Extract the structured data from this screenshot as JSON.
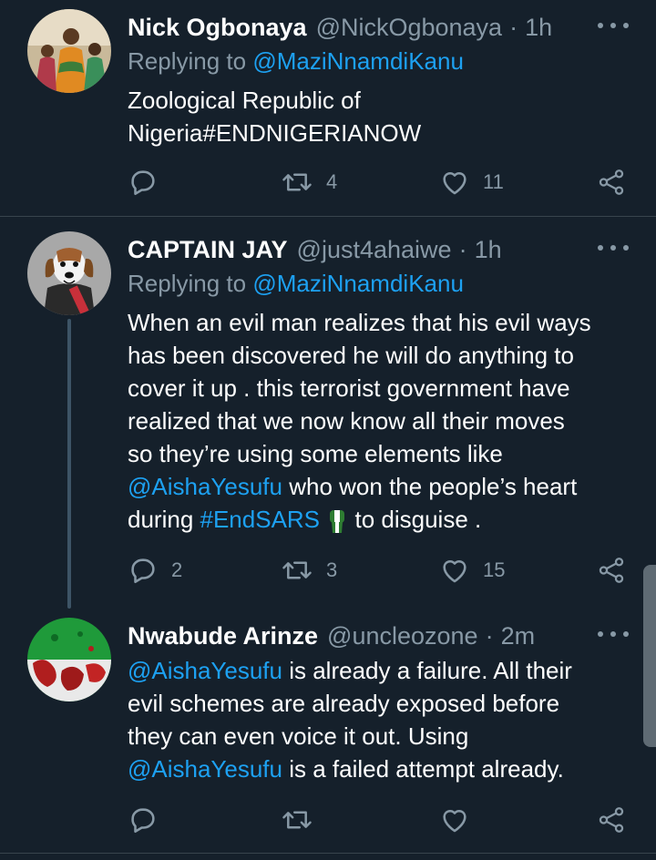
{
  "tweets": [
    {
      "name": "Nick Ogbonaya",
      "handle": "@NickOgbonaya",
      "sep": "·",
      "time": "1h",
      "replying_prefix": "Replying to",
      "replying_to": "@MaziNnamdiKanu",
      "text_line1": "Zoological Republic of",
      "text_line2": "Nigeria#ENDNIGERIANOW",
      "retweets": "4",
      "likes": "11"
    },
    {
      "name": "CAPTAIN JAY",
      "handle": "@just4ahaiwe",
      "sep": "·",
      "time": "1h",
      "replying_prefix": "Replying to",
      "replying_to": "@MaziNnamdiKanu",
      "lines": [
        "When an evil man realizes that his evil ways",
        "has been discovered he will do anything to",
        "cover it up . this terrorist government have",
        "realized that we now know all their moves",
        "so they’re using some elements like"
      ],
      "mention": "@AishaYesufu",
      "after_mention": " who won the people’s heart",
      "during": "during ",
      "hashtag": "#EndSARS",
      "tail": " to disguise .",
      "replies": "2",
      "retweets": "3",
      "likes": "15"
    },
    {
      "name": "Nwabude Arinze",
      "handle": "@uncleozone",
      "sep": "·",
      "time": "2m",
      "mention1": "@AishaYesufu",
      "line1_rest": " is already a failure. All their",
      "line2": "evil schemes are already exposed before",
      "line3": "they can even voice it out. Using",
      "mention2": "@AishaYesufu",
      "line4_rest": " is a failed attempt already."
    }
  ],
  "icons": {
    "reply": "reply-icon",
    "retweet": "retweet-icon",
    "like": "heart-icon",
    "share": "share-icon",
    "more": "more-icon"
  },
  "colors": {
    "background": "#15202b",
    "accent": "#1da1f2",
    "muted": "#8899a6"
  }
}
